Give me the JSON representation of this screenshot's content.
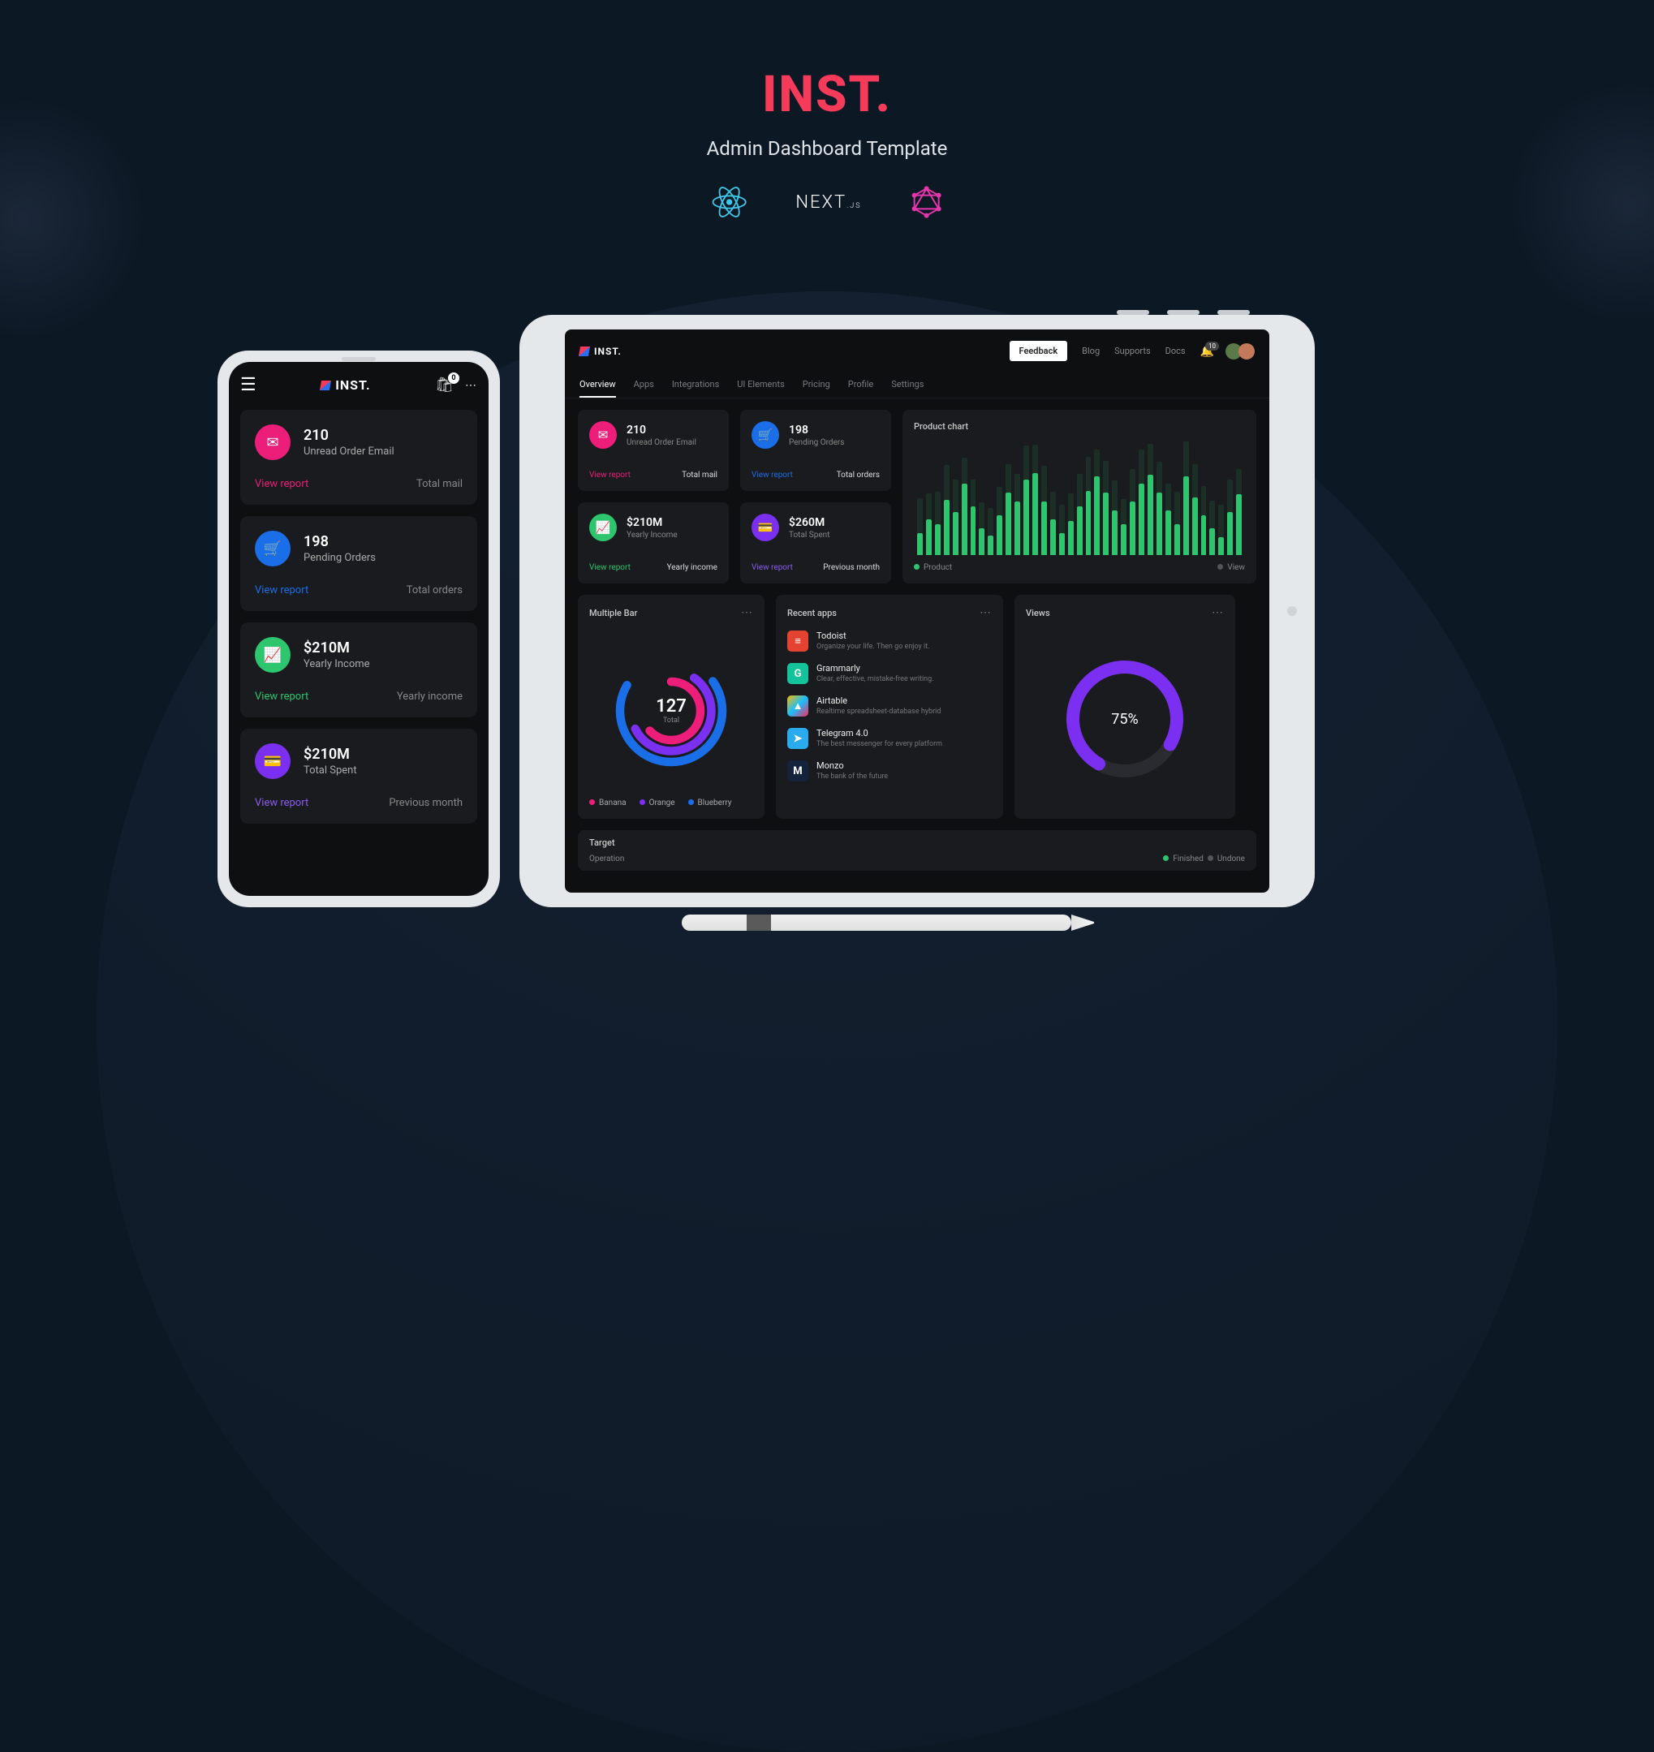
{
  "hero": {
    "logo": "INST.",
    "subtitle": "Admin Dashboard Template",
    "tech_next": "NEXT",
    "tech_next_suffix": ".JS"
  },
  "brand": "INST.",
  "tablet": {
    "feedback": "Feedback",
    "nav": {
      "blog": "Blog",
      "supports": "Supports",
      "docs": "Docs"
    },
    "notif_count": "10",
    "tabs": [
      "Overview",
      "Apps",
      "Integrations",
      "UI Elements",
      "Pricing",
      "Profile",
      "Settings"
    ],
    "stats": [
      {
        "value": "210",
        "label": "Unread Order Email",
        "view": "View report",
        "right": "Total mail",
        "color": "pink",
        "icon": "✉"
      },
      {
        "value": "198",
        "label": "Pending Orders",
        "view": "View report",
        "right": "Total orders",
        "color": "blue",
        "icon": "🛒"
      },
      {
        "value": "$210M",
        "label": "Yearly Income",
        "view": "View report",
        "right": "Yearly income",
        "color": "green",
        "icon": "📈"
      },
      {
        "value": "$260M",
        "label": "Total Spent",
        "view": "View report",
        "right": "Previous month",
        "color": "purple",
        "icon": "💳"
      }
    ],
    "product_chart": {
      "title": "Product chart",
      "legend_left": "Product",
      "legend_right": "View"
    },
    "multibar": {
      "title": "Multiple Bar",
      "center_num": "127",
      "center_sub": "Total",
      "legend": [
        "Banana",
        "Orange",
        "Blueberry"
      ]
    },
    "recent_apps": {
      "title": "Recent apps",
      "items": [
        {
          "name": "Todoist",
          "desc": "Organize your life. Then go enjoy it."
        },
        {
          "name": "Grammarly",
          "desc": "Clear, effective, mistake-free writing."
        },
        {
          "name": "Airtable",
          "desc": "Realtime spreadsheet-database hybrid"
        },
        {
          "name": "Telegram 4.0",
          "desc": "The best messenger for every platform"
        },
        {
          "name": "Monzo",
          "desc": "The bank of the future"
        }
      ]
    },
    "views": {
      "title": "Views",
      "percent": "75%"
    },
    "target": {
      "title": "Target",
      "operation": "Operation",
      "finished": "Finished",
      "undone": "Undone"
    }
  },
  "phone": {
    "bag_count": "0",
    "cards": [
      {
        "value": "210",
        "label": "Unread Order Email",
        "view": "View report",
        "right": "Total mail",
        "color": "pink",
        "icon": "✉"
      },
      {
        "value": "198",
        "label": "Pending Orders",
        "view": "View report",
        "right": "Total orders",
        "color": "blue",
        "icon": "🛒"
      },
      {
        "value": "$210M",
        "label": "Yearly Income",
        "view": "View report",
        "right": "Yearly income",
        "color": "green",
        "icon": "📈"
      },
      {
        "value": "$210M",
        "label": "Total Spent",
        "view": "View report",
        "right": "Previous month",
        "color": "purple",
        "icon": "💳"
      }
    ]
  },
  "chart_data": {
    "type": "bar",
    "title": "Product chart",
    "series": [
      {
        "name": "Product",
        "values": [
          25,
          40,
          35,
          62,
          48,
          80,
          55,
          30,
          22,
          45,
          70,
          60,
          85,
          92,
          60,
          40,
          25,
          38,
          55,
          72,
          88,
          70,
          50,
          35,
          60,
          80,
          90,
          70,
          50,
          35,
          88,
          65,
          45,
          30,
          20,
          48,
          68
        ]
      }
    ],
    "ylim": [
      0,
      100
    ]
  }
}
